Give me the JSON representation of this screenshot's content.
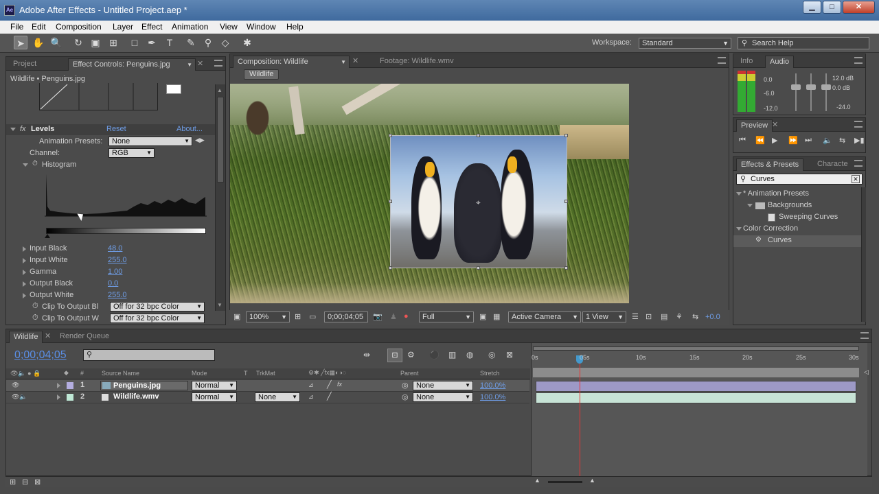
{
  "window": {
    "title": "Adobe After Effects - Untitled Project.aep *",
    "icon_text": "Ae",
    "min": "▁",
    "max": "□",
    "close": "✕"
  },
  "menu": [
    "File",
    "Edit",
    "Composition",
    "Layer",
    "Effect",
    "Animation",
    "View",
    "Window",
    "Help"
  ],
  "toolbar": {
    "workspace_label": "Workspace:",
    "workspace_value": "Standard",
    "search_placeholder": "Search Help"
  },
  "project_panel": {
    "tabs": [
      "Project",
      "Effect Controls: Penguins.jpg"
    ],
    "breadcrumb": "Wildlife • Penguins.jpg",
    "effect": {
      "name": "Levels",
      "reset": "Reset",
      "about": "About...",
      "presets_label": "Animation Presets:",
      "presets_value": "None",
      "channel_label": "Channel:",
      "channel_value": "RGB",
      "histogram_label": "Histogram"
    },
    "params": [
      {
        "label": "Input Black",
        "value": "48.0"
      },
      {
        "label": "Input White",
        "value": "255.0"
      },
      {
        "label": "Gamma",
        "value": "1.00"
      },
      {
        "label": "Output Black",
        "value": "0.0"
      },
      {
        "label": "Output White",
        "value": "255.0"
      }
    ],
    "clips": [
      {
        "label": "Clip To Output Bl",
        "value": "Off for 32 bpc Color"
      },
      {
        "label": "Clip To Output W",
        "value": "Off for 32 bpc Color"
      }
    ]
  },
  "comp_panel": {
    "tabs": [
      "Composition: Wildlife",
      "Footage: Wildlife.wmv"
    ],
    "comp_button": "Wildlife",
    "footer": {
      "zoom": "100%",
      "timecode": "0;00;04;05",
      "resolution": "Full",
      "camera": "Active Camera",
      "views": "1 View",
      "exposure": "+0.0"
    }
  },
  "info_panel": {
    "tabs": [
      "Info",
      "Audio"
    ],
    "levels_left": [
      "0.0",
      "-6.0",
      "-12.0"
    ],
    "levels_right": [
      "12.0 dB",
      "0.0 dB",
      "-24.0"
    ]
  },
  "preview_panel": {
    "tab": "Preview"
  },
  "effects_panel": {
    "tabs": [
      "Effects & Presets",
      "Characte"
    ],
    "search_value": "Curves",
    "tree": [
      {
        "label": "* Animation Presets"
      },
      {
        "label": "Backgrounds"
      },
      {
        "label": "Sweeping Curves"
      },
      {
        "label": "Color Correction"
      },
      {
        "label": "Curves"
      }
    ]
  },
  "timeline": {
    "tabs": [
      "Wildlife",
      "Render Queue"
    ],
    "timecode": "0;00;04;05",
    "headers": {
      "num": "#",
      "source": "Source Name",
      "mode": "Mode",
      "t": "T",
      "trkmat": "TrkMat",
      "parent": "Parent",
      "stretch": "Stretch"
    },
    "layers": [
      {
        "num": "1",
        "name": "Penguins.jpg",
        "mode": "Normal",
        "trkmat": "",
        "parent": "None",
        "stretch": "100.0%"
      },
      {
        "num": "2",
        "name": "Wildlife.wmv",
        "mode": "Normal",
        "trkmat": "None",
        "parent": "None",
        "stretch": "100.0%"
      }
    ],
    "ruler": [
      "0s",
      "05s",
      "10s",
      "15s",
      "20s",
      "25s",
      "30s"
    ]
  }
}
